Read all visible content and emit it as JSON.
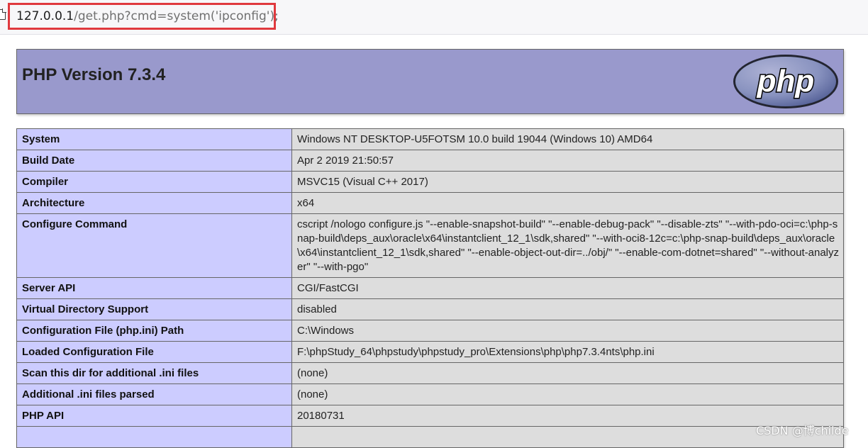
{
  "address_bar": {
    "url_host": "127.0.0.1",
    "url_path": "/get.php?cmd=system('ipconfig');"
  },
  "header": {
    "title": "PHP Version 7.3.4",
    "logo_text": "php"
  },
  "rows": [
    {
      "label": "System",
      "value": "Windows NT DESKTOP-U5FOTSM 10.0 build 19044 (Windows 10) AMD64"
    },
    {
      "label": "Build Date",
      "value": "Apr 2 2019 21:50:57"
    },
    {
      "label": "Compiler",
      "value": "MSVC15 (Visual C++ 2017)"
    },
    {
      "label": "Architecture",
      "value": "x64"
    },
    {
      "label": "Configure Command",
      "value": "cscript /nologo configure.js \"--enable-snapshot-build\" \"--enable-debug-pack\" \"--disable-zts\" \"--with-pdo-oci=c:\\php-snap-build\\deps_aux\\oracle\\x64\\instantclient_12_1\\sdk,shared\" \"--with-oci8-12c=c:\\php-snap-build\\deps_aux\\oracle\\x64\\instantclient_12_1\\sdk,shared\" \"--enable-object-out-dir=../obj/\" \"--enable-com-dotnet=shared\" \"--without-analyzer\" \"--with-pgo\""
    },
    {
      "label": "Server API",
      "value": "CGI/FastCGI"
    },
    {
      "label": "Virtual Directory Support",
      "value": "disabled"
    },
    {
      "label": "Configuration File (php.ini) Path",
      "value": "C:\\Windows"
    },
    {
      "label": "Loaded Configuration File",
      "value": "F:\\phpStudy_64\\phpstudy\\phpstudy_pro\\Extensions\\php\\php7.3.4nts\\php.ini"
    },
    {
      "label": "Scan this dir for additional .ini files",
      "value": "(none)"
    },
    {
      "label": "Additional .ini files parsed",
      "value": "(none)"
    },
    {
      "label": "PHP API",
      "value": "20180731"
    },
    {
      "label": "",
      "value": ""
    }
  ],
  "watermark": "CSDN @博childe",
  "colors": {
    "header_bg": "#9999cc",
    "label_cell_bg": "#ccccff",
    "value_cell_bg": "#dddddd",
    "url_highlight": "#e0393e"
  }
}
